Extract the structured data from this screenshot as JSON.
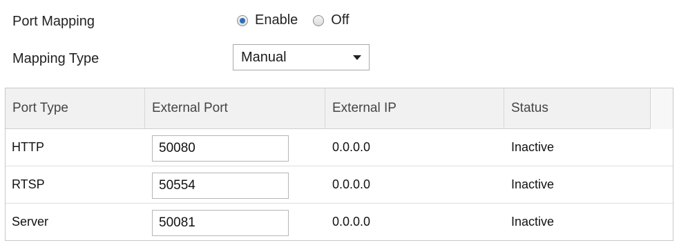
{
  "form": {
    "port_mapping_label": "Port Mapping",
    "enable_label": "Enable",
    "off_label": "Off",
    "port_mapping_selected": "Enable",
    "mapping_type_label": "Mapping Type",
    "mapping_type_value": "Manual"
  },
  "table": {
    "headers": {
      "port_type": "Port Type",
      "external_port": "External Port",
      "external_ip": "External IP",
      "status": "Status"
    },
    "rows": [
      {
        "port_type": "HTTP",
        "external_port": "50080",
        "external_ip": "0.0.0.0",
        "status": "Inactive"
      },
      {
        "port_type": "RTSP",
        "external_port": "50554",
        "external_ip": "0.0.0.0",
        "status": "Inactive"
      },
      {
        "port_type": "Server",
        "external_port": "50081",
        "external_ip": "0.0.0.0",
        "status": "Inactive"
      }
    ]
  },
  "colors": {
    "radio_selected": "#2b6fb8",
    "header_bg": "#f1f1f1"
  }
}
